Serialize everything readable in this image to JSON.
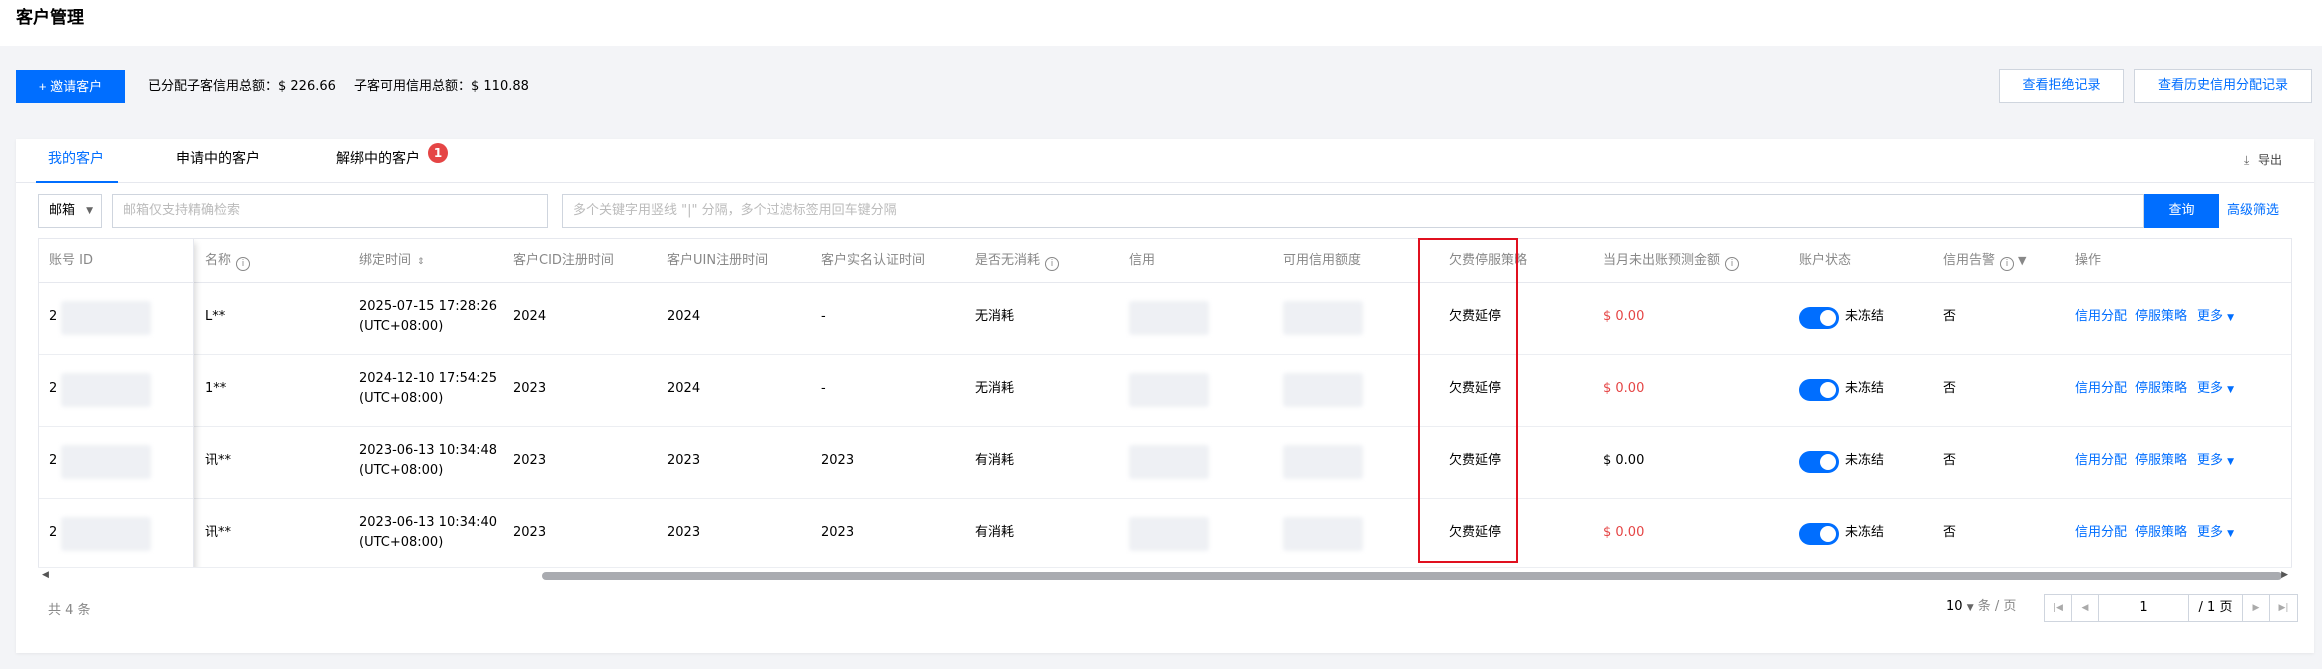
{
  "page": {
    "title": "客户管理"
  },
  "toolbar": {
    "invite_label": "+ 邀请客户",
    "allocated_total": "已分配子客信用总额：$ 226.66",
    "available_total": "子客可用信用总额：$ 110.88",
    "view_rejected_label": "查看拒绝记录",
    "view_history_label": "查看历史信用分配记录"
  },
  "tabs": [
    {
      "label": "我的客户",
      "active": true
    },
    {
      "label": "申请中的客户",
      "active": false
    },
    {
      "label": "解绑中的客户",
      "active": false,
      "badge": "1"
    }
  ],
  "export_label": "导出",
  "filter": {
    "select_value": "邮箱",
    "email_placeholder": "邮箱仅支持精确检索",
    "keyword_placeholder": "多个关键字用竖线 \"|\" 分隔，多个过滤标签用回车键分隔",
    "query_label": "查询",
    "advanced_label": "高级筛选"
  },
  "table": {
    "columns": [
      "账号 ID",
      "名称",
      "绑定时间",
      "客户CID注册时间",
      "客户UIN注册时间",
      "客户实名认证时间",
      "是否无消耗",
      "信用",
      "可用信用额度",
      "欠费停服策略",
      "当月未出账预测金额",
      "账户状态",
      "信用告警",
      "操作"
    ],
    "rows": [
      {
        "account_id": "2",
        "name": "L**",
        "bind_date": "2025-07-15 17:28:26",
        "bind_tz": "(UTC+08:00)",
        "cid_time": "2024",
        "uin_time": "2024",
        "realname_time": "-",
        "no_consumption": "无消耗",
        "policy": "欠费延停",
        "forecast": "$ 0.00",
        "forecast_red": true,
        "status": "未冻结",
        "alert": "否"
      },
      {
        "account_id": "2",
        "name": "1**",
        "bind_date": "2024-12-10 17:54:25",
        "bind_tz": "(UTC+08:00)",
        "cid_time": "2023",
        "uin_time": "2024",
        "realname_time": "-",
        "no_consumption": "无消耗",
        "policy": "欠费延停",
        "forecast": "$ 0.00",
        "forecast_red": true,
        "status": "未冻结",
        "alert": "否"
      },
      {
        "account_id": "2",
        "name": "讯**",
        "bind_date": "2023-06-13 10:34:48",
        "bind_tz": "(UTC+08:00)",
        "cid_time": "2023",
        "uin_time": "2023",
        "realname_time": "2023",
        "no_consumption": "有消耗",
        "policy": "欠费延停",
        "forecast": "$ 0.00",
        "forecast_red": false,
        "status": "未冻结",
        "alert": "否"
      },
      {
        "account_id": "2",
        "name": "讯**",
        "bind_date": "2023-06-13 10:34:40",
        "bind_tz": "(UTC+08:00)",
        "cid_time": "2023",
        "uin_time": "2023",
        "realname_time": "2023",
        "no_consumption": "有消耗",
        "policy": "欠费延停",
        "forecast": "$ 0.00",
        "forecast_red": true,
        "status": "未冻结",
        "alert": "否"
      }
    ],
    "actions": {
      "credit": "信用分配",
      "policy": "停服策略",
      "more": "更多"
    }
  },
  "footer": {
    "total": "共 4 条",
    "page_size": "10",
    "page_size_unit": "条 / 页",
    "current_page": "1",
    "total_pages": "/ 1 页"
  },
  "colors": {
    "primary": "#006eff",
    "danger": "#e54545",
    "highlight_border": "#e0101f"
  }
}
